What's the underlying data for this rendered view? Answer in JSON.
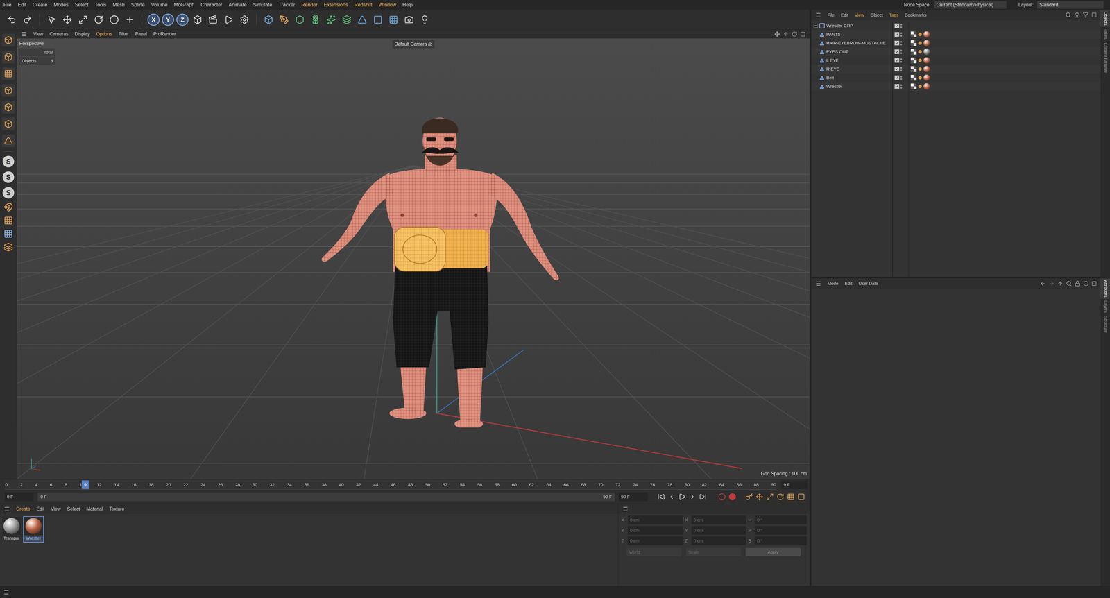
{
  "menubar": {
    "items": [
      {
        "label": "File",
        "highlighted": false
      },
      {
        "label": "Edit",
        "highlighted": false
      },
      {
        "label": "Create",
        "highlighted": false
      },
      {
        "label": "Modes",
        "highlighted": false
      },
      {
        "label": "Select",
        "highlighted": false
      },
      {
        "label": "Tools",
        "highlighted": false
      },
      {
        "label": "Mesh",
        "highlighted": false
      },
      {
        "label": "Spline",
        "highlighted": false
      },
      {
        "label": "Volume",
        "highlighted": false
      },
      {
        "label": "MoGraph",
        "highlighted": false
      },
      {
        "label": "Character",
        "highlighted": false
      },
      {
        "label": "Animate",
        "highlighted": false
      },
      {
        "label": "Simulate",
        "highlighted": false
      },
      {
        "label": "Tracker",
        "highlighted": false
      },
      {
        "label": "Render",
        "highlighted": true
      },
      {
        "label": "Extensions",
        "highlighted": true
      },
      {
        "label": "Redshift",
        "highlighted": true
      },
      {
        "label": "Window",
        "highlighted": true
      },
      {
        "label": "Help",
        "highlighted": false
      }
    ],
    "node_space_label": "Node Space:",
    "node_space_value": "Current (Standard/Physical)",
    "layout_label": "Layout:",
    "layout_value": "Standard"
  },
  "toolbar": {
    "axis_buttons": [
      "X",
      "Y",
      "Z"
    ]
  },
  "left_toolbar": {
    "snap_buttons": [
      "S",
      "S",
      "S"
    ]
  },
  "viewport": {
    "menu": [
      {
        "label": "View",
        "highlighted": false
      },
      {
        "label": "Cameras",
        "highlighted": false
      },
      {
        "label": "Display",
        "highlighted": false
      },
      {
        "label": "Options",
        "highlighted": true
      },
      {
        "label": "Filter",
        "highlighted": false
      },
      {
        "label": "Panel",
        "highlighted": false
      },
      {
        "label": "ProRender",
        "highlighted": false
      }
    ],
    "view_name": "Perspective",
    "camera": "Default Camera",
    "hud": {
      "header": "Total",
      "rows": [
        {
          "label": "Objects",
          "value": "8"
        }
      ]
    },
    "grid_spacing": "Grid Spacing : 100 cm"
  },
  "timeline": {
    "ticks": [
      "0",
      "2",
      "4",
      "6",
      "8",
      "10",
      "12",
      "14",
      "16",
      "18",
      "20",
      "22",
      "24",
      "26",
      "28",
      "30",
      "32",
      "34",
      "36",
      "38",
      "40",
      "42",
      "44",
      "46",
      "48",
      "50",
      "52",
      "54",
      "56",
      "58",
      "60",
      "62",
      "64",
      "66",
      "68",
      "70",
      "72",
      "74",
      "76",
      "78",
      "80",
      "82",
      "84",
      "86",
      "88",
      "90"
    ],
    "playhead": {
      "label": "9",
      "level": 0.1
    },
    "end_field": "9 F",
    "start_field": "0 F",
    "range_start": "0 F",
    "range_end": "90 F",
    "max_field": "90 F"
  },
  "materials": {
    "menu": [
      {
        "label": "Create",
        "highlighted": true
      },
      {
        "label": "Edit",
        "highlighted": false
      },
      {
        "label": "View",
        "highlighted": false
      },
      {
        "label": "Select",
        "highlighted": false
      },
      {
        "label": "Material",
        "highlighted": false
      },
      {
        "label": "Texture",
        "highlighted": false
      }
    ],
    "items": [
      {
        "label": "Transpar",
        "selected": false,
        "color": "#9a9a9a"
      },
      {
        "label": "Wrestler",
        "selected": true,
        "color": "#b8603f"
      }
    ]
  },
  "coordinates": {
    "rows": [
      {
        "pos_label": "X",
        "pos": "0 cm",
        "size_label": "X",
        "size": "0 cm",
        "rot_label": "H",
        "rot": "0 °"
      },
      {
        "pos_label": "Y",
        "pos": "0 cm",
        "size_label": "Y",
        "size": "0 cm",
        "rot_label": "P",
        "rot": "0 °"
      },
      {
        "pos_label": "Z",
        "pos": "0 cm",
        "size_label": "Z",
        "size": "0 cm",
        "rot_label": "B",
        "rot": "0 °"
      }
    ],
    "mode": "World",
    "size_mode": "Scale",
    "apply": "Apply"
  },
  "objects_manager": {
    "menu": [
      {
        "label": "File",
        "highlighted": false
      },
      {
        "label": "Edit",
        "highlighted": false
      },
      {
        "label": "View",
        "highlighted": true
      },
      {
        "label": "Object",
        "highlighted": false
      },
      {
        "label": "Tags",
        "highlighted": true
      },
      {
        "label": "Bookmarks",
        "highlighted": false
      }
    ],
    "root": {
      "name": "Wrestler GRP",
      "expanded": true,
      "enabled": true,
      "children": [
        {
          "name": "PANTS",
          "enabled": true,
          "material_color": "#c5684a"
        },
        {
          "name": "HAIR-EYEBROW-MUSTACHE",
          "enabled": true,
          "material_color": "#c5684a"
        },
        {
          "name": "EYES OUT",
          "enabled": true,
          "material_color": "#8c8c8c"
        },
        {
          "name": "L EYE",
          "enabled": true,
          "material_color": "#c5684a"
        },
        {
          "name": "R EYE",
          "enabled": true,
          "material_color": "#c5684a"
        },
        {
          "name": "Belt",
          "enabled": true,
          "material_color": "#c5684a"
        },
        {
          "name": "Wrestler",
          "enabled": true,
          "material_color": "#c5684a"
        }
      ]
    }
  },
  "attributes": {
    "menu": [
      "Mode",
      "Edit",
      "User Data"
    ]
  },
  "side_tabs_top": [
    {
      "label": "Objects",
      "selected": true
    },
    {
      "label": "Takes",
      "selected": false
    },
    {
      "label": "Content Browser",
      "selected": false
    }
  ],
  "side_tabs_bottom": [
    {
      "label": "Attributes",
      "selected": true
    },
    {
      "label": "Layers",
      "selected": false
    },
    {
      "label": "Structure",
      "selected": false
    }
  ]
}
